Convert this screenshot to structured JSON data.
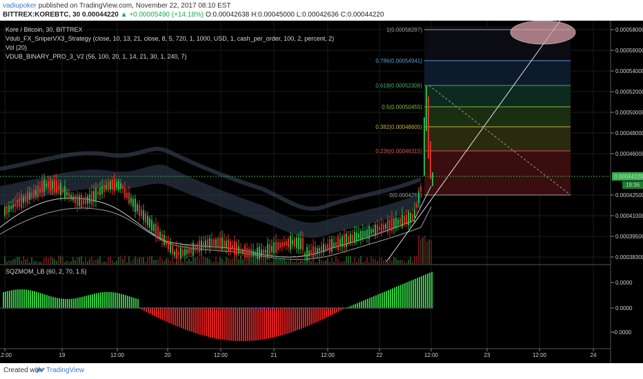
{
  "header": {
    "author": "vadiupoker",
    "published_text": "published on TradingView.com, November 22, 2017 08:10 EST",
    "symbol": "BITTREX:KOREBTC, 30",
    "last": "0.00044220",
    "change": "▲ +0.00005490 (+14.18%)",
    "ohlc": "O:0.00042638 H:0.00045000 L:0.00042636 C:0.00044220"
  },
  "legend": {
    "title": "Kore / Bitcoin, 30, BITTREX",
    "ind1": "Vdub_FX_SniperVX3_Strategy (close, 10, 13, 21, close, 8, 5, 720, 1, 1000, USD, 1, cash_per_order, 100, 2, percent, 2)",
    "ind2": "Vol (20)",
    "ind3": "VDUB_BINARY_PRO_3_V2 (56, 100, 20, 1, 14, 21, 30, 1, 240, 7)",
    "osc": "SQZMOM_LB (60, 2, 70, 1.5)"
  },
  "price_axis": {
    "ticks": [
      "0.00058000",
      "0.00056000",
      "0.00054000",
      "0.00052000",
      "0.00050000",
      "0.00048000",
      "0.00046000",
      "0.00042500",
      "0.00041000",
      "0.00039500",
      "0.00038300"
    ],
    "current_price": "0.00044220",
    "countdown": "19:36"
  },
  "osc_axis": {
    "ticks": [
      "0.0000",
      "0.0000",
      "-0.0000"
    ]
  },
  "time_axis": {
    "labels": [
      "12:00",
      "19",
      "12:00",
      "20",
      "12:00",
      "21",
      "12:00",
      "22",
      "12:00",
      "23",
      "12:00",
      "24"
    ]
  },
  "fib_levels": [
    {
      "label": "1(0.00058297)",
      "color": "#9aa0a6"
    },
    {
      "label": "0.786(0.00054941)",
      "color": "#5b9bd5"
    },
    {
      "label": "0.618(0.00052306)",
      "color": "#3cb371"
    },
    {
      "label": "0.5(0.00050455)",
      "color": "#7cbf3a"
    },
    {
      "label": "0.382(0.00048605)",
      "color": "#c6b23a"
    },
    {
      "label": "0.236(0.00046315)",
      "color": "#d9534f"
    },
    {
      "label": "0(0.0004261)",
      "color": "#9aa0a6"
    }
  ],
  "colors": {
    "bull": "#2fb34a",
    "bear": "#d9312b",
    "osc_pos": "#2ecc40",
    "osc_neg": "#e02020"
  },
  "footer": {
    "created_with": "Created with",
    "brand": "TradingView"
  }
}
